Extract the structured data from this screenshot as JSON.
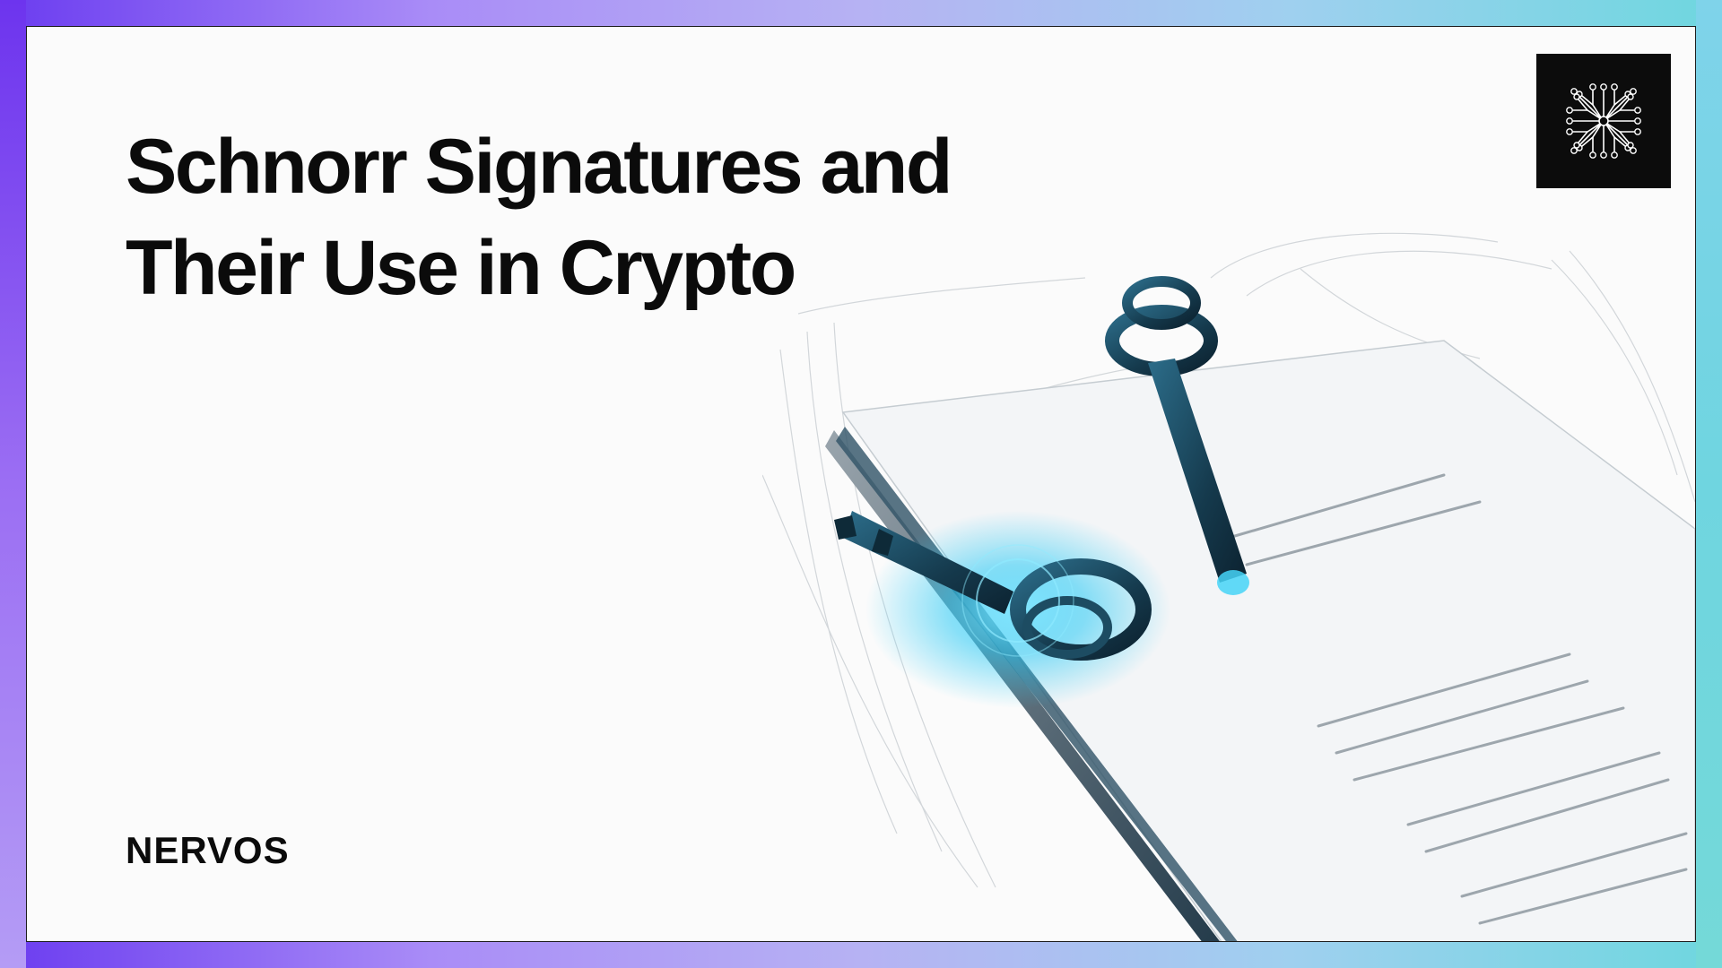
{
  "slide": {
    "title_line1": "Schnorr Signatures and",
    "title_line2": "Their Use in Crypto",
    "brand_logo_text": "NERVOS"
  },
  "icons": {
    "brand_mark": "circuit-tree-icon",
    "illustration": "keys-on-documents-illustration"
  },
  "colors": {
    "border_gradient_start": "#6b3cf0",
    "border_gradient_end": "#6ed7df",
    "title": "#0b0b0b",
    "brand_box": "#0c0c0c",
    "key_glow": "#27c9f5",
    "key_metal": "#1f4f66"
  }
}
